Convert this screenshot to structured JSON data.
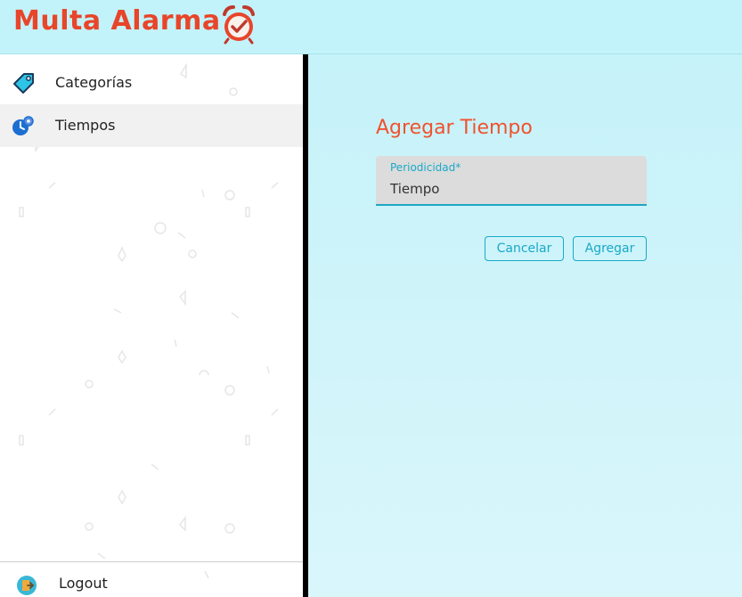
{
  "header": {
    "app_name": "Multa Alarma",
    "logo_icon": "alarm-clock-check-icon"
  },
  "sidebar": {
    "items": [
      {
        "label": "Categorías",
        "icon": "tag-icon"
      },
      {
        "label": "Tiempos",
        "icon": "clock-gear-icon",
        "active": true
      }
    ],
    "logout": {
      "label": "Logout",
      "icon": "logout-icon"
    }
  },
  "form": {
    "title": "Agregar Tiempo",
    "field_label": "Periodicidad*",
    "field_value": "Tiempo",
    "cancel_label": "Cancelar",
    "submit_label": "Agregar"
  },
  "colors": {
    "brand": "#e8452a",
    "accent": "#1aa9c7",
    "header_bg": "#c3f3fa",
    "title": "#f0522e"
  }
}
